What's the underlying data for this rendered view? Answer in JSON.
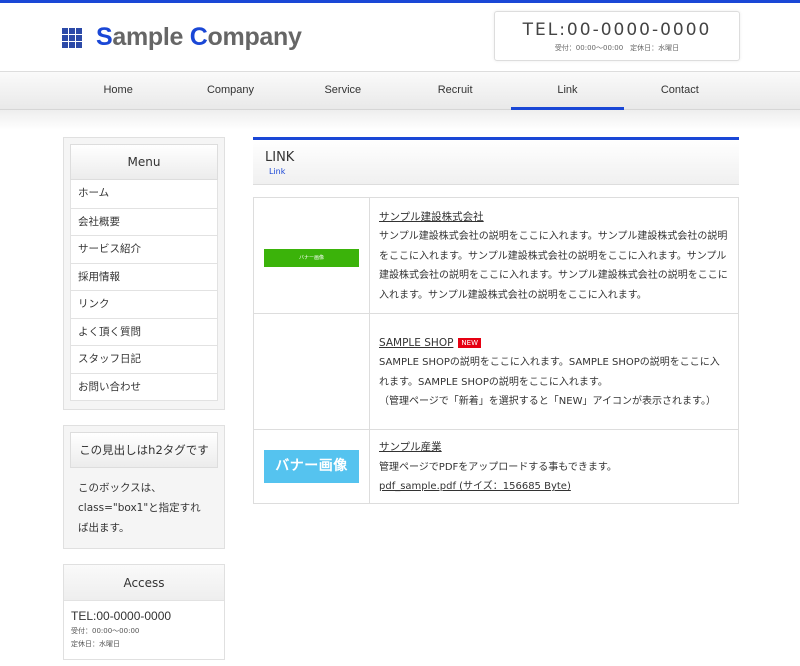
{
  "header": {
    "logo_text_parts": [
      "S",
      "ample ",
      "C",
      "ompany"
    ],
    "tel": "TEL:00-0000-0000",
    "hours": "受付：00:00〜00:00　定休日：水曜日"
  },
  "nav": {
    "items": [
      {
        "label": "Home"
      },
      {
        "label": "Company"
      },
      {
        "label": "Service"
      },
      {
        "label": "Recruit"
      },
      {
        "label": "Link"
      },
      {
        "label": "Contact"
      }
    ],
    "active": "Link"
  },
  "sidebar": {
    "menu_title": "Menu",
    "menu_items": [
      {
        "label": "ホーム"
      },
      {
        "label": "会社概要"
      },
      {
        "label": "サービス紹介"
      },
      {
        "label": "採用情報"
      },
      {
        "label": "リンク"
      },
      {
        "label": "よく頂く質問"
      },
      {
        "label": "スタッフ日記"
      },
      {
        "label": "お問い合わせ"
      }
    ],
    "h2box": {
      "title": "この見出しはh2タグです",
      "text": "このボックスは、class=\"box1\"と指定すれば出ます。"
    },
    "access": {
      "title": "Access",
      "tel": "TEL:00-0000-0000",
      "hours": "受付：00:00〜00:00",
      "closed": "定休日：水曜日"
    }
  },
  "main": {
    "title": "LINK",
    "subtitle": "Link",
    "links": [
      {
        "banner_text": "バナー画像",
        "title": "サンプル建設株式会社",
        "description": "サンプル建設株式会社の説明をここに入れます。サンプル建設株式会社の説明をここに入れます。サンプル建設株式会社の説明をここに入れます。サンプル建設株式会社の説明をここに入れます。サンプル建設株式会社の説明をここに入れます。サンプル建設株式会社の説明をここに入れます。"
      },
      {
        "title": "SAMPLE SHOP",
        "badge": "NEW",
        "description": "SAMPLE SHOPの説明をここに入れます。SAMPLE SHOPの説明をここに入れます。SAMPLE SHOPの説明をここに入れます。",
        "note": "（管理ページで「新着」を選択すると「NEW」アイコンが表示されます。）"
      },
      {
        "banner_text": "バナー画像",
        "title": "サンプル産業",
        "description": "管理ページでPDFをアップロードする事もできます。",
        "file_link": "pdf_sample.pdf (サイズ：156685 Byte)"
      }
    ]
  },
  "colors": {
    "accent": "#1a47d6",
    "banner_green": "#3bb30a",
    "banner_blue": "#55c3ef",
    "badge_red": "#e60012"
  }
}
